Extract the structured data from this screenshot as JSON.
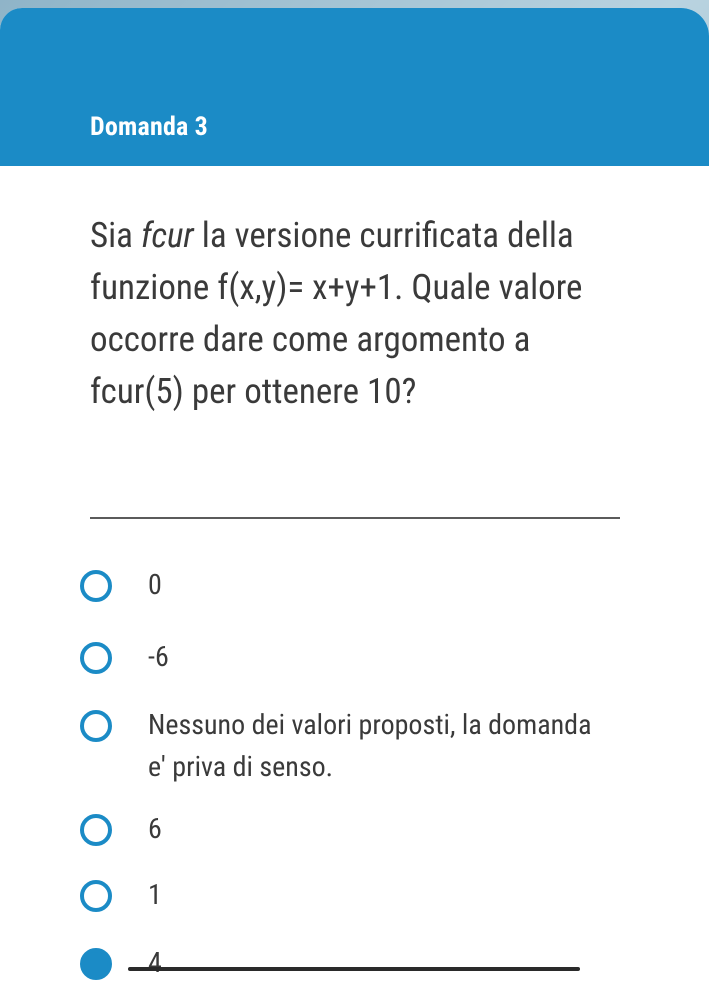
{
  "card": {
    "title": "Domanda 3"
  },
  "question": {
    "part1": "Sia ",
    "italic": "fcur",
    "part2": " la versione currificata della funzione f(x,y)= x+y+1. Quale valore occorre dare come argomento  a fcur(5) per ottenere 10?"
  },
  "options": [
    {
      "label": "0",
      "selected": false
    },
    {
      "label": "-6",
      "selected": false
    },
    {
      "label": "Nessuno dei valori proposti, la domanda e' priva di senso.",
      "selected": false
    },
    {
      "label": "6",
      "selected": false
    },
    {
      "label": "1",
      "selected": false
    },
    {
      "label": "4",
      "selected": true
    }
  ],
  "colors": {
    "accent": "#1b8bc6",
    "text": "#3a3a3a",
    "header_text": "#ffffff"
  }
}
